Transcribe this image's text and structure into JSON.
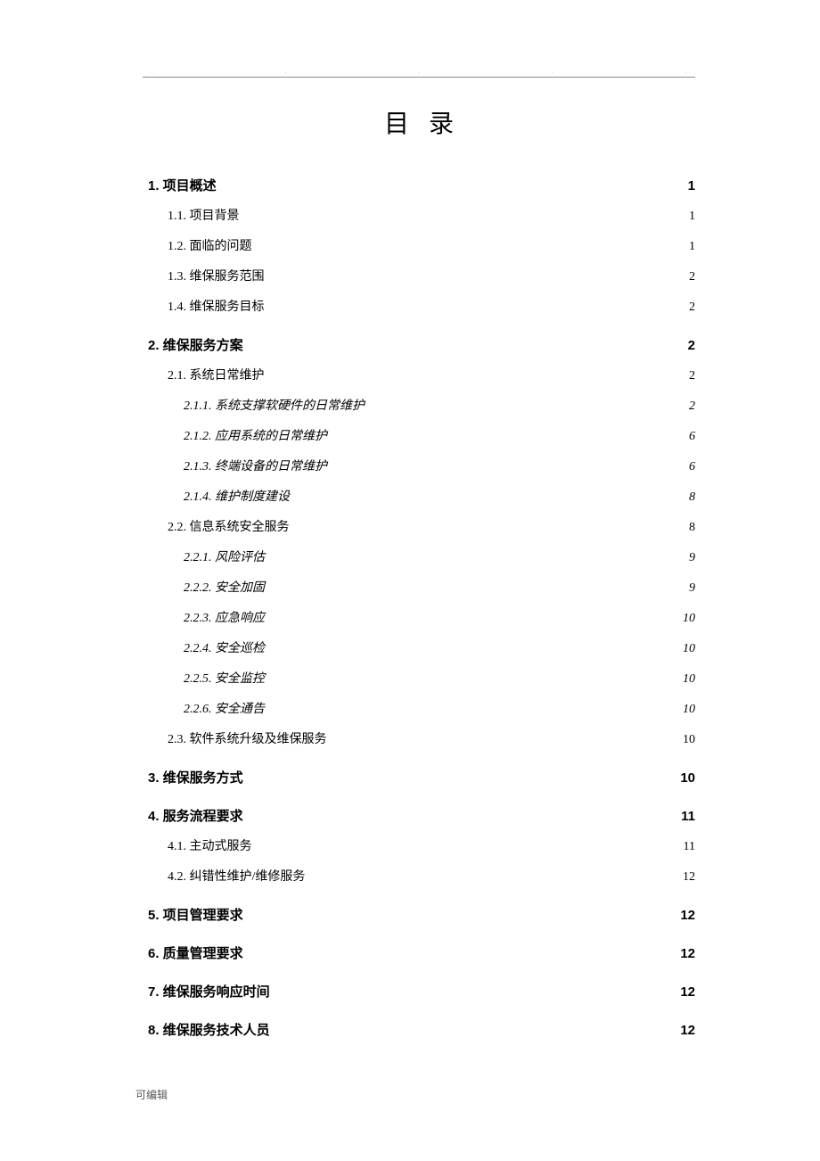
{
  "title": "目录",
  "footer": "可编辑",
  "entries": [
    {
      "level": 1,
      "num": "1.",
      "text": "项目概述",
      "page": "1"
    },
    {
      "level": 2,
      "num": "1.1.",
      "text": "项目背景",
      "page": "1"
    },
    {
      "level": 2,
      "num": "1.2.",
      "text": "面临的问题",
      "page": "1"
    },
    {
      "level": 2,
      "num": "1.3.",
      "text": "维保服务范围",
      "page": "2"
    },
    {
      "level": 2,
      "num": "1.4.",
      "text": "维保服务目标",
      "page": "2"
    },
    {
      "level": 1,
      "num": "2.",
      "text": "维保服务方案",
      "page": "2"
    },
    {
      "level": 2,
      "num": "2.1.",
      "text": "系统日常维护",
      "page": "2"
    },
    {
      "level": 3,
      "num": "2.1.1.",
      "text": "系统支撑软硬件的日常维护",
      "page": "2"
    },
    {
      "level": 3,
      "num": "2.1.2.",
      "text": "应用系统的日常维护",
      "page": "6"
    },
    {
      "level": 3,
      "num": "2.1.3.",
      "text": "终端设备的日常维护",
      "page": "6"
    },
    {
      "level": 3,
      "num": "2.1.4.",
      "text": "维护制度建设",
      "page": "8"
    },
    {
      "level": 2,
      "num": "2.2.",
      "text": "信息系统安全服务",
      "page": "8"
    },
    {
      "level": 3,
      "num": "2.2.1.",
      "text": "风险评估",
      "page": "9"
    },
    {
      "level": 3,
      "num": "2.2.2.",
      "text": "安全加固",
      "page": "9"
    },
    {
      "level": 3,
      "num": "2.2.3.",
      "text": "应急响应",
      "page": "10"
    },
    {
      "level": 3,
      "num": "2.2.4.",
      "text": "安全巡检",
      "page": "10"
    },
    {
      "level": 3,
      "num": "2.2.5.",
      "text": "安全监控",
      "page": "10"
    },
    {
      "level": 3,
      "num": "2.2.6.",
      "text": "安全通告",
      "page": "10"
    },
    {
      "level": 2,
      "num": "2.3.",
      "text": "软件系统升级及维保服务",
      "page": "10"
    },
    {
      "level": 1,
      "num": "3.",
      "text": "维保服务方式",
      "page": "10"
    },
    {
      "level": 1,
      "num": "4.",
      "text": "服务流程要求",
      "page": "11"
    },
    {
      "level": 2,
      "num": "4.1.",
      "text": "主动式服务",
      "page": "11"
    },
    {
      "level": 2,
      "num": "4.2.",
      "text": "纠错性维护/维修服务",
      "page": "12"
    },
    {
      "level": 1,
      "num": "5.",
      "text": "项目管理要求",
      "page": "12"
    },
    {
      "level": 1,
      "num": "6.",
      "text": "质量管理要求",
      "page": "12"
    },
    {
      "level": 1,
      "num": "7.",
      "text": "维保服务响应时间",
      "page": "12"
    },
    {
      "level": 1,
      "num": "8.",
      "text": "维保服务技术人员",
      "page": "12"
    }
  ]
}
